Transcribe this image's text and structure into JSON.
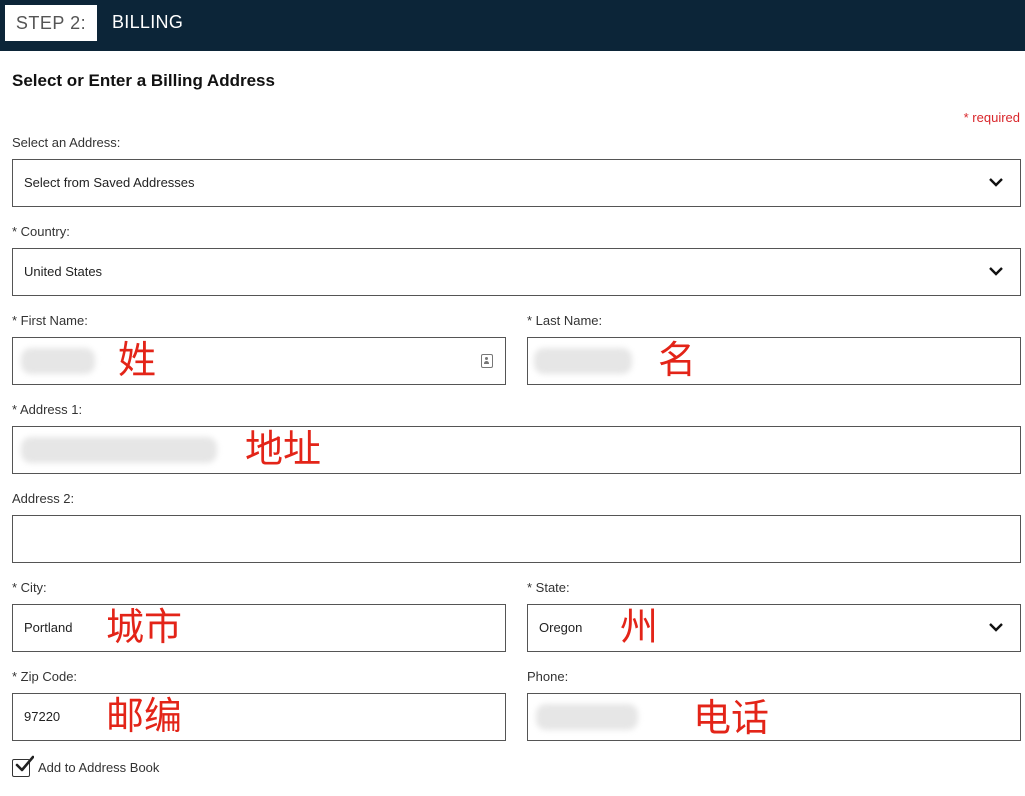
{
  "header": {
    "step_label": "STEP 2:",
    "title": "BILLING"
  },
  "form": {
    "section_title": "Select or Enter a Billing Address",
    "required_note": "* required",
    "saved_address": {
      "label": "Select an Address:",
      "value": "Select from Saved Addresses"
    },
    "country": {
      "label": "* Country:",
      "value": "United States"
    },
    "first_name": {
      "label": "* First Name:",
      "annotation": "姓"
    },
    "last_name": {
      "label": "* Last Name:",
      "annotation": "名"
    },
    "address1": {
      "label": "* Address 1:",
      "annotation": "地址"
    },
    "address2": {
      "label": "Address 2:",
      "value": ""
    },
    "city": {
      "label": "* City:",
      "value": "Portland",
      "annotation": "城市"
    },
    "state": {
      "label": "* State:",
      "value": "Oregon",
      "annotation": "州"
    },
    "zip": {
      "label": "* Zip Code:",
      "value": "97220",
      "annotation": "邮编"
    },
    "phone": {
      "label": "Phone:",
      "annotation": "电话"
    },
    "add_to_book": {
      "label": "Add to Address Book",
      "checked": true
    }
  },
  "colors": {
    "header_bg": "#0c2538",
    "required": "#d9262b",
    "annotation": "#e32418"
  },
  "icons": [
    "chevron-down-icon",
    "contact-card-icon",
    "checkmark-icon"
  ]
}
